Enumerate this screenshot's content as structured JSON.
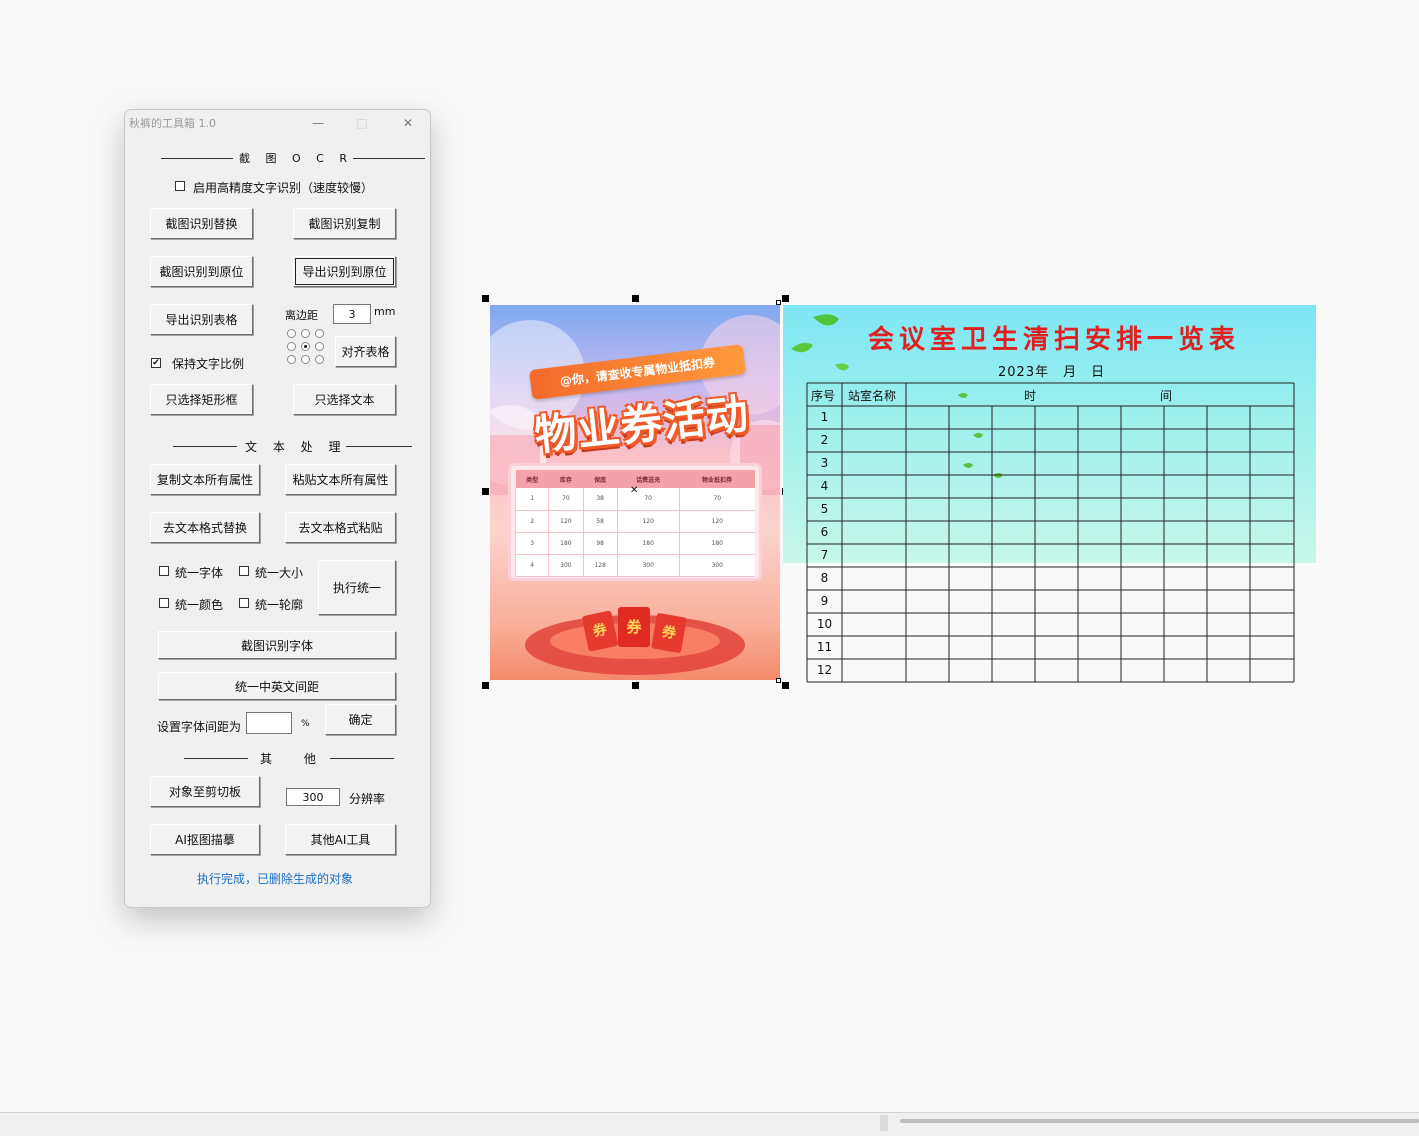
{
  "window": {
    "title": "秋裤的工具箱 1.0",
    "minimize_icon": "—",
    "maximize_icon": "□",
    "close_icon": "✕"
  },
  "ocr": {
    "section_title": "截 图 O C R",
    "high_precision_label": "启用高精度文字识别（速度较慢）",
    "high_precision_checked": false,
    "btn_replace": "截图识别替换",
    "btn_copy": "截图识别复制",
    "btn_to_origin": "截图识别到原位",
    "btn_export_to_origin": "导出识别到原位",
    "btn_export_table": "导出识别表格",
    "margin_label": "离边距",
    "margin_value": "3",
    "margin_unit": "mm",
    "keep_ratio_label": "保持文字比例",
    "keep_ratio_checked": true,
    "check_mark": "✔",
    "btn_align_table": "对齐表格",
    "btn_select_rect": "只选择矩形框",
    "btn_select_text": "只选择文本"
  },
  "text": {
    "section_title": "文 本 处 理",
    "btn_copy_props": "复制文本所有属性",
    "btn_paste_props": "粘贴文本所有属性",
    "btn_strip_replace": "去文本格式替换",
    "btn_strip_paste": "去文本格式粘贴",
    "chk_font": "统一字体",
    "chk_size": "统一大小",
    "chk_color": "统一颜色",
    "chk_outline": "统一轮廓",
    "btn_apply_unify": "执行统一",
    "btn_detect_font": "截图识别字体",
    "btn_unify_spacing": "统一中英文间距",
    "spacing_label": "设置字体间距为",
    "spacing_value": "",
    "spacing_unit": "%",
    "btn_confirm": "确定"
  },
  "other": {
    "section_title": "其 他",
    "btn_to_clipboard": "对象至剪切板",
    "resolution_value": "300",
    "resolution_label": "分辨率",
    "btn_ai_trace": "AI抠图描摹",
    "btn_other_ai": "其他AI工具"
  },
  "status": {
    "message": "执行完成，已删除生成的对象",
    "color": "#1b6fc6"
  },
  "poster": {
    "ribbon_text": "@你，请查收专属物业抵扣券",
    "headline": "物业券活动",
    "table_headers": [
      "类型",
      "库存",
      "保底",
      "话费送充",
      "物业抵扣券"
    ],
    "table_rows": [
      [
        "1",
        "70",
        "38",
        "70",
        "70"
      ],
      [
        "2",
        "120",
        "58",
        "120",
        "120"
      ],
      [
        "3",
        "180",
        "98",
        "180",
        "180"
      ],
      [
        "4",
        "300",
        "128",
        "300",
        "300"
      ]
    ],
    "coupon_text": "券",
    "cross_icon": "✕"
  },
  "sheet": {
    "title": "会议室卫生清扫安排一览表",
    "date_line": "2023年　月　日",
    "col_no": "序号",
    "col_room": "站室名称",
    "col_time_a": "时",
    "col_time_b": "间",
    "rows": [
      "1",
      "2",
      "3",
      "4",
      "5",
      "6",
      "7",
      "8",
      "9",
      "10",
      "11",
      "12"
    ]
  },
  "colors": {
    "accent_red": "#e02020",
    "poster_orange": "#f36b2c",
    "sheet_cyan": "#7ee6f4"
  }
}
